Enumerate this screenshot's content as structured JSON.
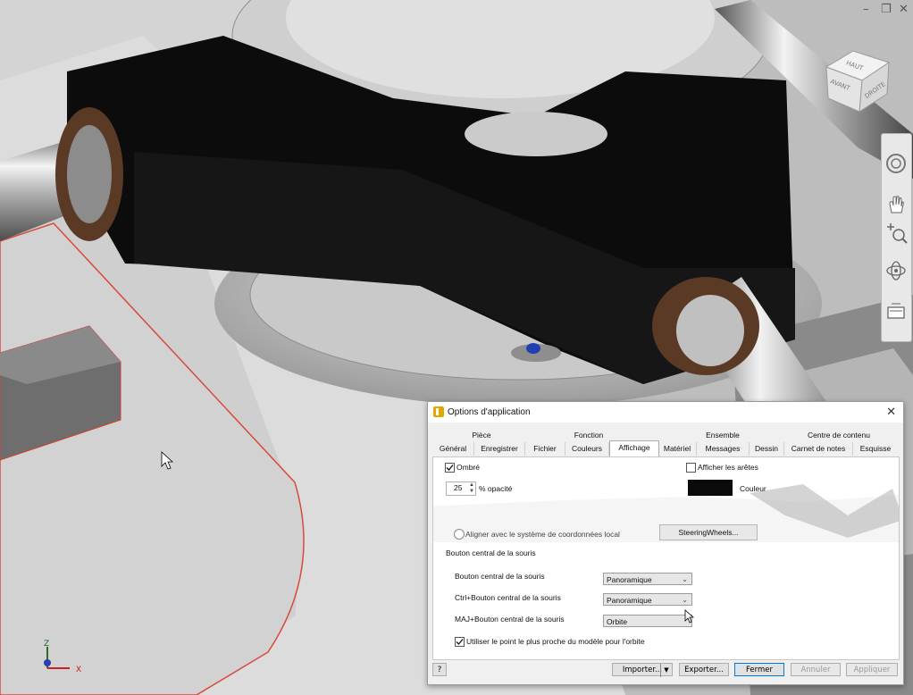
{
  "viewcube": {
    "top": "HAUT",
    "front": "AVANT",
    "right": "DROITE"
  },
  "axes": {
    "z": "Z",
    "x": "X"
  },
  "window_controls": {
    "minimize": "–",
    "restore": "❐",
    "close": "✕"
  },
  "dialog": {
    "title": "Options d'application",
    "close": "✕",
    "tabs_row1": [
      "Pièce",
      "Fonction",
      "Ensemble",
      "Centre de contenu"
    ],
    "tabs_row2": [
      "Général",
      "Enregistrer",
      "Fichier",
      "Couleurs",
      "Affichage",
      "Matériel",
      "Messages",
      "Dessin",
      "Carnet de notes",
      "Esquisse"
    ],
    "selected_tab": "Affichage",
    "shaded_label": "Ombré",
    "opacity_value": "25",
    "opacity_label": "% opacité",
    "show_edges_label": "Afficher les arêtes",
    "color_label": "Couleur",
    "align_label": "Aligner avec le système de coordonnées local",
    "steering_button": "SteeringWheels...",
    "middle_section": "Bouton central de la souris",
    "row1_label": "Bouton central de la souris",
    "row1_value": "Panoramique",
    "row2_label": "Ctrl+Bouton central de la souris",
    "row2_value": "Panoramique",
    "row3_label": "MAJ+Bouton central de la souris",
    "row3_value": "Orbite",
    "closest_point_label": "Utiliser le point le plus proche du modèle pour l'orbite",
    "help": "?",
    "import": "Importer...",
    "export": "Exporter...",
    "close_btn": "Fermer",
    "cancel": "Annuler",
    "apply": "Appliquer"
  }
}
